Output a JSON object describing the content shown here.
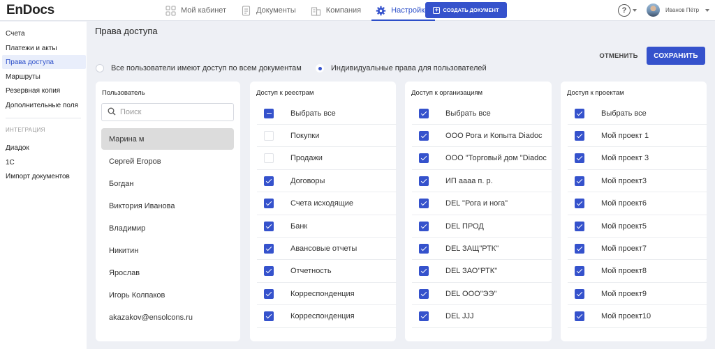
{
  "app": {
    "logo": "EnDocs",
    "nav": [
      {
        "label": "Мой кабинет",
        "icon": "grid-icon"
      },
      {
        "label": "Документы",
        "icon": "document-icon"
      },
      {
        "label": "Компания",
        "icon": "building-icon"
      },
      {
        "label": "Настройки",
        "icon": "gear-icon",
        "active": true
      }
    ],
    "create_button": "СОЗДАТЬ ДОКУМЕНТ",
    "help_label": "?",
    "user_name": "Иванов Пётр",
    "accent_color": "#3552cc"
  },
  "sidebar": {
    "items": [
      {
        "label": "Счета"
      },
      {
        "label": "Платежи и акты"
      },
      {
        "label": "Права доступа",
        "active": true
      },
      {
        "label": "Маршруты"
      },
      {
        "label": "Резервная копия"
      },
      {
        "label": "Дополнительные поля"
      }
    ],
    "section_title": "ИНТЕГРАЦИЯ",
    "integration_items": [
      {
        "label": "Диадок"
      },
      {
        "label": "1С"
      },
      {
        "label": "Импорт документов"
      }
    ]
  },
  "main": {
    "title": "Права доступа",
    "cancel_label": "ОТМЕНИТЬ",
    "save_label": "СОХРАНИТЬ",
    "access_modes": [
      {
        "label": "Все пользователи имеют доступ по всем документам",
        "selected": false
      },
      {
        "label": "Индивидуальные права для пользователей",
        "selected": true
      }
    ],
    "users_panel": {
      "title": "Пользователь",
      "search_placeholder": "Поиск",
      "users": [
        "Марина м",
        "Сергей Егоров",
        "Богдан",
        "Виктория Иванова",
        "Владимир",
        "Никитин",
        "Ярослав",
        "Игорь Колпаков",
        "akazakov@ensolcons.ru"
      ],
      "selected_index": 0
    },
    "registries_panel": {
      "title": "Доступ к реестрам",
      "select_all": {
        "label": "Выбрать все",
        "state": "partial"
      },
      "items": [
        {
          "label": "Покупки",
          "checked": false
        },
        {
          "label": "Продажи",
          "checked": false
        },
        {
          "label": "Договоры",
          "checked": true
        },
        {
          "label": "Счета исходящие",
          "checked": true
        },
        {
          "label": "Банк",
          "checked": true
        },
        {
          "label": "Авансовые отчеты",
          "checked": true
        },
        {
          "label": "Отчетность",
          "checked": true
        },
        {
          "label": "Корреспонденция",
          "checked": true
        },
        {
          "label": "Корреспонденция",
          "checked": true
        }
      ]
    },
    "orgs_panel": {
      "title": "Доступ к организациям",
      "select_all": {
        "label": "Выбрать все",
        "state": "checked"
      },
      "items": [
        {
          "label": "ООО Рога и Копыта Diadoc",
          "checked": true
        },
        {
          "label": "ООО \"Торговый дом \"Diadoc",
          "checked": true
        },
        {
          "label": "ИП аааа п. р.",
          "checked": true
        },
        {
          "label": "DEL \"Рога и нога\"",
          "checked": true
        },
        {
          "label": "DEL ПРОД",
          "checked": true
        },
        {
          "label": "DEL ЗАЩ\"РТК\"",
          "checked": true
        },
        {
          "label": "DEL ЗАО\"РТК\"",
          "checked": true
        },
        {
          "label": "DEL ООО\"ЭЭ\"",
          "checked": true
        },
        {
          "label": "DEL JJJ",
          "checked": true
        }
      ]
    },
    "projects_panel": {
      "title": "Доступ к проектам",
      "select_all": {
        "label": "Выбрать все",
        "state": "checked"
      },
      "items": [
        {
          "label": "Мой проект 1",
          "checked": true
        },
        {
          "label": "Мой проект 3",
          "checked": true
        },
        {
          "label": "Мой проект3",
          "checked": true
        },
        {
          "label": "Мой проект6",
          "checked": true
        },
        {
          "label": "Мой проект5",
          "checked": true
        },
        {
          "label": "Мой проект7",
          "checked": true
        },
        {
          "label": "Мой проект8",
          "checked": true
        },
        {
          "label": "Мой проект9",
          "checked": true
        },
        {
          "label": "Мой проект10",
          "checked": true
        }
      ]
    }
  }
}
